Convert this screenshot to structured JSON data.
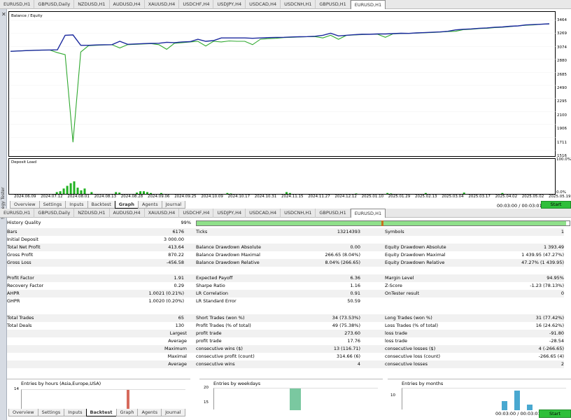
{
  "top_tabs": [
    "EURUSD,H1",
    "GBPUSD,Daily",
    "NZDUSD,H1",
    "AUDUSD,H4",
    "XAUUSD,H4",
    "USDCHF,H4",
    "USDJPY,H4",
    "USDCAD,H4",
    "USDCNH,H1",
    "GBPUSD,H1",
    "EURUSD,H1"
  ],
  "top_tabs_active": 10,
  "chart": {
    "legend": "Balance / Equity",
    "y_ticks": [
      "3464",
      "3269",
      "3074",
      "2880",
      "2685",
      "2490",
      "2295",
      "2100",
      "1906",
      "1711",
      "1516"
    ],
    "x_ticks": [
      "2024.06.09",
      "2024.07.12",
      "2024.08.01",
      "2024.08.13",
      "2024.08.28",
      "2024.09.06",
      "2024.09.25",
      "2024.10.09",
      "2024.10.17",
      "2024.10.31",
      "2024.11.15",
      "2024.11.27",
      "2024.12.12",
      "2025.01.10",
      "2025.01.29",
      "2025.02.13",
      "2025.03.04",
      "2025.03.17",
      "2025.04.02",
      "2025.05.02",
      "2025.05.19"
    ],
    "deposit_label": "Deposit Load",
    "deposit_ticks": [
      "100.0%",
      "0.0%"
    ],
    "colors": {
      "balance": "#1c2a9e",
      "equity": "#2fa82f",
      "load": "#1fb21f"
    }
  },
  "chart_data": {
    "type": "line",
    "title": "",
    "ylim": [
      1516,
      3464
    ],
    "series": [
      {
        "name": "Balance",
        "values": [
          3000,
          3005,
          3010,
          3015,
          3018,
          3020,
          3022,
          3240,
          3245,
          3090,
          3090,
          3095,
          3098,
          3100,
          3150,
          3105,
          3110,
          3115,
          3118,
          3120,
          3135,
          3130,
          3140,
          3145,
          3180,
          3150,
          3160,
          3200,
          3200,
          3200,
          3200,
          3195,
          3200,
          3205,
          3208,
          3210,
          3215,
          3218,
          3220,
          3225,
          3240,
          3270,
          3230,
          3240,
          3248,
          3255,
          3255,
          3260,
          3260,
          3265,
          3270,
          3268,
          3275,
          3280,
          3285,
          3290,
          3300,
          3320,
          3330,
          3335,
          3345,
          3350,
          3360,
          3365,
          3375,
          3380,
          3395,
          3400,
          3405,
          3412
        ]
      },
      {
        "name": "Equity",
        "values": [
          3000,
          3005,
          3010,
          3015,
          3018,
          3020,
          2980,
          2950,
          1640,
          2990,
          3085,
          3090,
          3095,
          3098,
          3050,
          3100,
          3105,
          3110,
          3115,
          3100,
          3030,
          3120,
          3130,
          3140,
          3150,
          3080,
          3150,
          3140,
          3155,
          3150,
          3150,
          3100,
          3180,
          3190,
          3195,
          3205,
          3210,
          3215,
          3218,
          3220,
          3200,
          3240,
          3180,
          3238,
          3245,
          3250,
          3255,
          3256,
          3210,
          3262,
          3265,
          3268,
          3272,
          3278,
          3282,
          3288,
          3295,
          3300,
          3325,
          3330,
          3340,
          3345,
          3355,
          3360,
          3370,
          3380,
          3390,
          3395,
          3405,
          3410
        ]
      }
    ],
    "deposit_load": [
      0,
      0,
      0,
      0,
      0,
      0,
      0,
      0,
      0,
      0,
      0,
      0,
      0,
      4,
      6,
      12,
      18,
      24,
      28,
      14,
      8,
      12,
      0,
      4,
      0,
      0,
      0,
      0,
      0,
      0,
      4,
      3,
      0,
      0,
      0,
      0,
      3,
      6,
      6,
      4,
      2,
      0,
      0,
      2,
      0,
      0,
      0,
      0,
      0,
      0,
      0,
      0,
      0,
      0,
      0,
      0,
      0,
      0,
      0,
      0,
      0,
      0,
      2,
      1,
      0,
      0,
      0,
      0,
      0,
      0,
      0,
      0,
      0,
      0,
      0,
      0,
      0,
      0,
      0,
      4,
      2,
      0,
      0,
      0,
      0,
      0,
      0,
      0,
      0,
      0,
      0,
      0,
      0,
      0,
      0,
      0,
      0,
      0,
      0,
      1,
      0,
      0,
      0,
      0,
      0,
      0,
      0,
      0,
      2,
      1,
      0,
      0,
      0,
      0,
      0,
      0,
      0,
      0,
      0,
      2,
      0,
      0,
      0,
      0,
      0,
      0,
      0,
      0,
      0,
      0,
      3,
      0,
      0,
      0,
      0,
      0,
      0,
      0,
      0,
      0,
      0,
      2,
      0,
      0,
      0,
      0,
      0,
      0,
      0,
      0,
      0,
      0,
      0,
      0,
      0,
      0
    ]
  },
  "side_label": "Strategy Tester",
  "bottom_tabs_1": [
    "Overview",
    "Settings",
    "Inputs",
    "Backtest",
    "Graph",
    "Agents",
    "Journal"
  ],
  "bottom_tabs_1_active": 4,
  "timer": "00:03:00 / 00:03:01",
  "start_label": "Start",
  "mid_tabs": [
    "EURUSD,H1",
    "GBPUSD,Daily",
    "NZDUSD,H1",
    "AUDUSD,H4",
    "XAUUSD,H4",
    "USDCHF,H4",
    "USDJPY,H4",
    "USDCAD,H4",
    "USDCNH,H1",
    "GBPUSD,H1",
    "EURUSD,H1"
  ],
  "mid_tabs_active": 10,
  "report": {
    "history_quality_label": "History Quality",
    "history_quality_value": "99%",
    "history_quality_fill": 0.99,
    "rows": [
      {
        "y": 326,
        "c": [
          [
            "Bars",
            "6176"
          ],
          [
            "Ticks",
            "13214393"
          ],
          [
            "Symbols",
            "1"
          ]
        ],
        "shade": true
      },
      {
        "y": 337,
        "c": [
          [
            "Initial Deposit",
            "3 000.00"
          ],
          [
            "",
            ""
          ],
          [
            "",
            ""
          ]
        ]
      },
      {
        "y": 348,
        "c": [
          [
            "Total Net Profit",
            "413.64"
          ],
          [
            "Balance Drawdown Absolute",
            "0.00"
          ],
          [
            "Equity Drawdown Absolute",
            "1 393.49"
          ]
        ],
        "shade": true
      },
      {
        "y": 359,
        "c": [
          [
            "Gross Profit",
            "870.22"
          ],
          [
            "Balance Drawdown Maximal",
            "266.65 (8.04%)"
          ],
          [
            "Equity Drawdown Maximal",
            "1 439.95 (47.27%)"
          ]
        ]
      },
      {
        "y": 370,
        "c": [
          [
            "Gross Loss",
            "-456.58"
          ],
          [
            "Balance Drawdown Relative",
            "8.04% (266.65)"
          ],
          [
            "Equity Drawdown Relative",
            "47.27% (1 439.95)"
          ]
        ],
        "shade": true
      },
      {
        "y": 392,
        "c": [
          [
            "Profit Factor",
            "1.91"
          ],
          [
            "Expected Payoff",
            "6.36"
          ],
          [
            "Margin Level",
            "94.95%"
          ]
        ],
        "shade": true
      },
      {
        "y": 403,
        "c": [
          [
            "Recovery Factor",
            "0.29"
          ],
          [
            "Sharpe Ratio",
            "1.16"
          ],
          [
            "Z-Score",
            "-1.23 (78.13%)"
          ]
        ]
      },
      {
        "y": 414,
        "c": [
          [
            "AHPR",
            "1.0021 (0.21%)"
          ],
          [
            "LR Correlation",
            "0.91"
          ],
          [
            "OnTester result",
            "0"
          ]
        ],
        "shade": true
      },
      {
        "y": 425,
        "c": [
          [
            "GHPR",
            "1.0020 (0.20%)"
          ],
          [
            "LR Standard Error",
            "50.59"
          ],
          [
            "",
            ""
          ]
        ]
      },
      {
        "y": 449,
        "c": [
          [
            "Total Trades",
            "65"
          ],
          [
            "Short Trades (won %)",
            "34 (73.53%)"
          ],
          [
            "Long Trades (won %)",
            "31 (77.42%)"
          ]
        ],
        "shade": true
      },
      {
        "y": 460,
        "c": [
          [
            "Total Deals",
            "130"
          ],
          [
            "Profit Trades (% of total)",
            "49 (75.38%)"
          ],
          [
            "Loss Trades (% of total)",
            "16 (24.62%)"
          ]
        ]
      },
      {
        "y": 471,
        "c": [
          [
            "Largest",
            "profit trade",
            "273.60"
          ],
          [
            "loss trade",
            "-91.80"
          ]
        ],
        "shade": true,
        "kind": "sub"
      },
      {
        "y": 482,
        "c": [
          [
            "Average",
            "profit trade",
            "17.76"
          ],
          [
            "loss trade",
            "-28.54"
          ]
        ],
        "kind": "sub"
      },
      {
        "y": 493,
        "c": [
          [
            "Maximum",
            "consecutive wins ($)",
            "13 (116.71)"
          ],
          [
            "consecutive losses ($)",
            "4 (-266.65)"
          ]
        ],
        "shade": true,
        "kind": "sub"
      },
      {
        "y": 504,
        "c": [
          [
            "Maximal",
            "consecutive profit (count)",
            "314.66 (6)"
          ],
          [
            "consecutive loss (count)",
            "-266.65 (4)"
          ]
        ],
        "kind": "sub"
      },
      {
        "y": 515,
        "c": [
          [
            "Average",
            "consecutive wins",
            "4"
          ],
          [
            "consecutive losses",
            "2"
          ]
        ],
        "shade": true,
        "kind": "sub"
      }
    ]
  },
  "mini_charts": [
    {
      "title": "Entries by hours (Asia,Europe,USA)",
      "ytick": "14"
    },
    {
      "title": "Entries by weekdays",
      "ytick": "20",
      "ytick2": "15"
    },
    {
      "title": "Entries by months",
      "ytick": "10"
    }
  ],
  "bottom_tabs_2": [
    "Overview",
    "Settings",
    "Inputs",
    "Backtest",
    "Graph",
    "Agents",
    "Journal"
  ],
  "bottom_tabs_2_active": 3,
  "timer2": "00:03:00 / 00:03:01",
  "start_label2": "Start"
}
